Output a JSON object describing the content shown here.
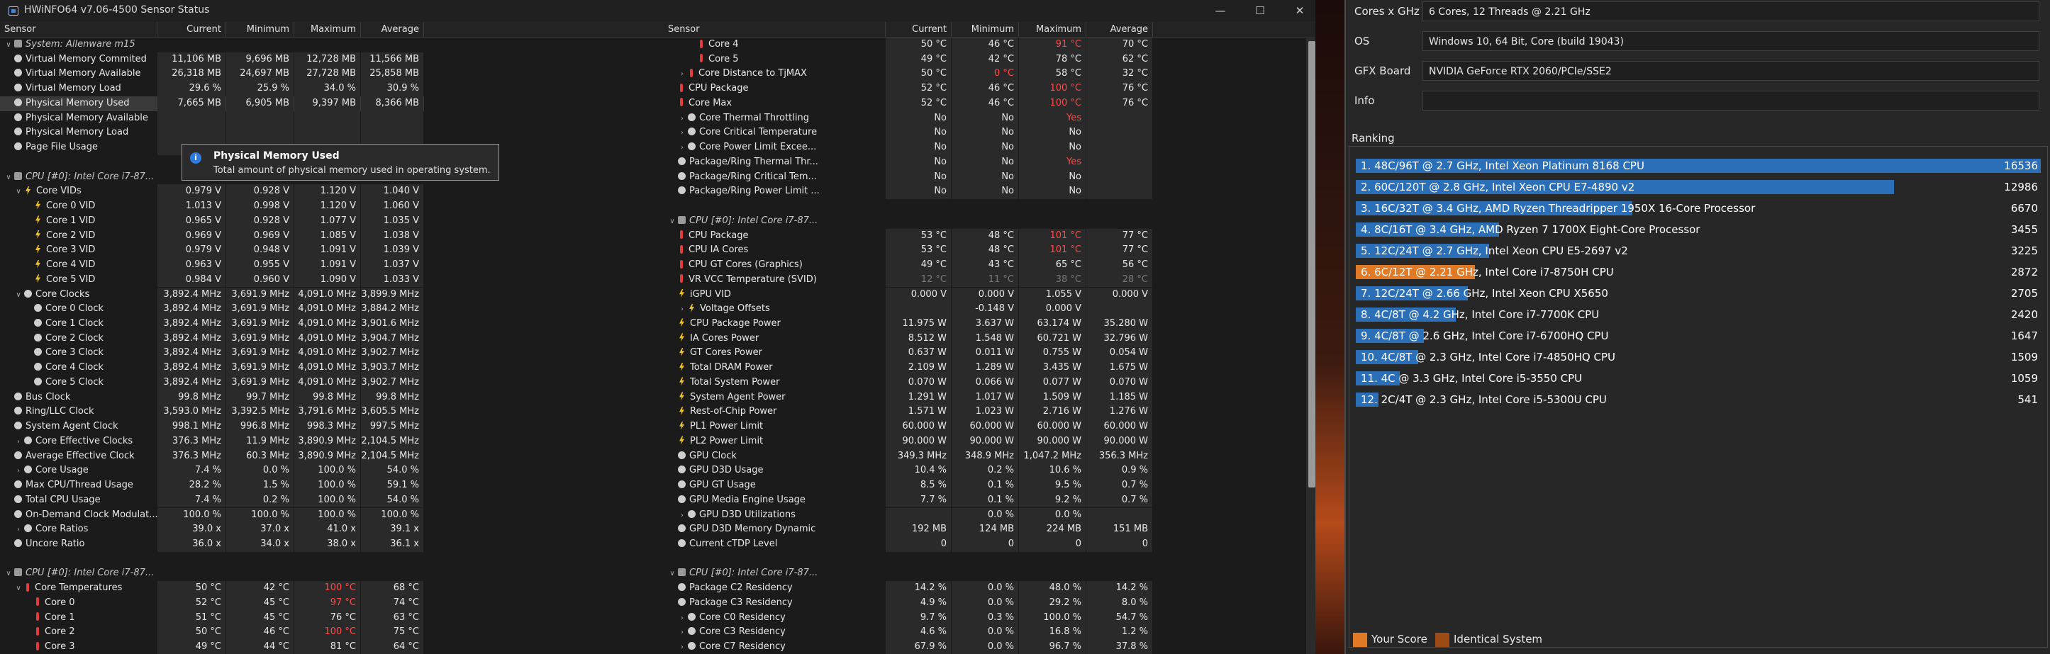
{
  "window": {
    "title": "HWiNFO64 v7.06-4500 Sensor Status",
    "minimize": "—",
    "maximize": "☐",
    "close": "✕"
  },
  "columns": {
    "sensor": "Sensor",
    "current": "Current",
    "minimum": "Minimum",
    "maximum": "Maximum",
    "average": "Average"
  },
  "left_rows": [
    {
      "name": "System: Allenware m15",
      "kind": "grp",
      "arrow": "v",
      "icon": "chip",
      "cur": "",
      "min": "",
      "max": "",
      "avg": ""
    },
    {
      "name": "Virtual Memory Commited",
      "icon": "dot",
      "cur": "11,106 MB",
      "min": "9,696 MB",
      "max": "12,728 MB",
      "avg": "11,566 MB"
    },
    {
      "name": "Virtual Memory Available",
      "icon": "dot",
      "cur": "26,318 MB",
      "min": "24,697 MB",
      "max": "27,728 MB",
      "avg": "25,858 MB"
    },
    {
      "name": "Virtual Memory Load",
      "icon": "dot",
      "cur": "29.6 %",
      "min": "25.9 %",
      "max": "34.0 %",
      "avg": "30.9 %"
    },
    {
      "name": "Physical Memory Used",
      "icon": "dot",
      "cur": "7,665 MB",
      "min": "6,905 MB",
      "max": "9,397 MB",
      "avg": "8,366 MB",
      "sel": true
    },
    {
      "name": "Physical Memory Available",
      "icon": "dot",
      "cur": "",
      "min": "",
      "max": "",
      "avg": ""
    },
    {
      "name": "Physical Memory Load",
      "icon": "dot",
      "cur": "",
      "min": "",
      "max": "",
      "avg": ""
    },
    {
      "name": "Page File Usage",
      "icon": "dot",
      "cur": "",
      "min": "",
      "max": "",
      "avg": ""
    },
    {
      "name": "",
      "kind": "blank",
      "cur": "",
      "min": "",
      "max": "",
      "avg": ""
    },
    {
      "name": "CPU [#0]: Intel Core i7-87...",
      "kind": "grp",
      "arrow": "v",
      "icon": "chip",
      "cur": "",
      "min": "",
      "max": "",
      "avg": ""
    },
    {
      "name": "Core VIDs",
      "indent": 1,
      "arrow": "v",
      "icon": "bolt",
      "cur": "0.979 V",
      "min": "0.928 V",
      "max": "1.120 V",
      "avg": "1.040 V"
    },
    {
      "name": "Core 0 VID",
      "indent": 2,
      "icon": "bolt",
      "cur": "1.013 V",
      "min": "0.998 V",
      "max": "1.120 V",
      "avg": "1.060 V"
    },
    {
      "name": "Core 1 VID",
      "indent": 2,
      "icon": "bolt",
      "cur": "0.965 V",
      "min": "0.928 V",
      "max": "1.077 V",
      "avg": "1.035 V"
    },
    {
      "name": "Core 2 VID",
      "indent": 2,
      "icon": "bolt",
      "cur": "0.969 V",
      "min": "0.969 V",
      "max": "1.085 V",
      "avg": "1.038 V"
    },
    {
      "name": "Core 3 VID",
      "indent": 2,
      "icon": "bolt",
      "cur": "0.979 V",
      "min": "0.948 V",
      "max": "1.091 V",
      "avg": "1.039 V"
    },
    {
      "name": "Core 4 VID",
      "indent": 2,
      "icon": "bolt",
      "cur": "0.963 V",
      "min": "0.955 V",
      "max": "1.091 V",
      "avg": "1.037 V"
    },
    {
      "name": "Core 5 VID",
      "indent": 2,
      "icon": "bolt",
      "cur": "0.984 V",
      "min": "0.960 V",
      "max": "1.090 V",
      "avg": "1.033 V"
    },
    {
      "name": "Core Clocks",
      "indent": 1,
      "arrow": "v",
      "icon": "dot",
      "cur": "3,892.4 MHz",
      "min": "3,691.9 MHz",
      "max": "4,091.0 MHz",
      "avg": "3,899.9 MHz"
    },
    {
      "name": "Core 0 Clock",
      "indent": 2,
      "icon": "dot",
      "cur": "3,892.4 MHz",
      "min": "3,691.9 MHz",
      "max": "4,091.0 MHz",
      "avg": "3,884.2 MHz"
    },
    {
      "name": "Core 1 Clock",
      "indent": 2,
      "icon": "dot",
      "cur": "3,892.4 MHz",
      "min": "3,691.9 MHz",
      "max": "4,091.0 MHz",
      "avg": "3,901.6 MHz"
    },
    {
      "name": "Core 2 Clock",
      "indent": 2,
      "icon": "dot",
      "cur": "3,892.4 MHz",
      "min": "3,691.9 MHz",
      "max": "4,091.0 MHz",
      "avg": "3,904.7 MHz"
    },
    {
      "name": "Core 3 Clock",
      "indent": 2,
      "icon": "dot",
      "cur": "3,892.4 MHz",
      "min": "3,691.9 MHz",
      "max": "4,091.0 MHz",
      "avg": "3,902.7 MHz"
    },
    {
      "name": "Core 4 Clock",
      "indent": 2,
      "icon": "dot",
      "cur": "3,892.4 MHz",
      "min": "3,691.9 MHz",
      "max": "4,091.0 MHz",
      "avg": "3,903.7 MHz"
    },
    {
      "name": "Core 5 Clock",
      "indent": 2,
      "icon": "dot",
      "cur": "3,892.4 MHz",
      "min": "3,691.9 MHz",
      "max": "4,091.0 MHz",
      "avg": "3,902.7 MHz"
    },
    {
      "name": "Bus Clock",
      "icon": "dot",
      "cur": "99.8 MHz",
      "min": "99.7 MHz",
      "max": "99.8 MHz",
      "avg": "99.8 MHz"
    },
    {
      "name": "Ring/LLC Clock",
      "icon": "dot",
      "cur": "3,593.0 MHz",
      "min": "3,392.5 MHz",
      "max": "3,791.6 MHz",
      "avg": "3,605.5 MHz"
    },
    {
      "name": "System Agent Clock",
      "icon": "dot",
      "cur": "998.1 MHz",
      "min": "996.8 MHz",
      "max": "998.3 MHz",
      "avg": "997.5 MHz"
    },
    {
      "name": "Core Effective Clocks",
      "indent": 1,
      "arrow": ">",
      "icon": "dot",
      "cur": "376.3 MHz",
      "min": "11.9 MHz",
      "max": "3,890.9 MHz",
      "avg": "2,104.5 MHz"
    },
    {
      "name": "Average Effective Clock",
      "icon": "dot",
      "cur": "376.3 MHz",
      "min": "60.3 MHz",
      "max": "3,890.9 MHz",
      "avg": "2,104.5 MHz"
    },
    {
      "name": "Core Usage",
      "indent": 1,
      "arrow": ">",
      "icon": "dot",
      "cur": "7.4 %",
      "min": "0.0 %",
      "max": "100.0 %",
      "avg": "54.0 %"
    },
    {
      "name": "Max CPU/Thread Usage",
      "icon": "dot",
      "cur": "28.2 %",
      "min": "1.5 %",
      "max": "100.0 %",
      "avg": "59.1 %"
    },
    {
      "name": "Total CPU Usage",
      "icon": "dot",
      "cur": "7.4 %",
      "min": "0.2 %",
      "max": "100.0 %",
      "avg": "54.0 %"
    },
    {
      "name": "On-Demand Clock Modulat...",
      "icon": "dot",
      "cur": "100.0 %",
      "min": "100.0 %",
      "max": "100.0 %",
      "avg": "100.0 %"
    },
    {
      "name": "Core Ratios",
      "indent": 1,
      "arrow": ">",
      "icon": "dot",
      "cur": "39.0 x",
      "min": "37.0 x",
      "max": "41.0 x",
      "avg": "39.1 x"
    },
    {
      "name": "Uncore Ratio",
      "icon": "dot",
      "cur": "36.0 x",
      "min": "34.0 x",
      "max": "38.0 x",
      "avg": "36.1 x"
    },
    {
      "name": "",
      "kind": "blank",
      "cur": "",
      "min": "",
      "max": "",
      "avg": ""
    },
    {
      "name": "CPU [#0]: Intel Core i7-87...",
      "kind": "grp",
      "arrow": "v",
      "icon": "chip",
      "cur": "",
      "min": "",
      "max": "",
      "avg": ""
    },
    {
      "name": "Core Temperatures",
      "indent": 1,
      "arrow": "v",
      "icon": "th",
      "cur": "50 °C",
      "min": "42 °C",
      "max": "100 °C",
      "avg": "68 °C",
      "maxred": true
    },
    {
      "name": "Core 0",
      "indent": 2,
      "icon": "th",
      "cur": "52 °C",
      "min": "45 °C",
      "max": "97 °C",
      "avg": "74 °C",
      "maxred": true
    },
    {
      "name": "Core 1",
      "indent": 2,
      "icon": "th",
      "cur": "51 °C",
      "min": "45 °C",
      "max": "76 °C",
      "avg": "63 °C"
    },
    {
      "name": "Core 2",
      "indent": 2,
      "icon": "th",
      "cur": "50 °C",
      "min": "46 °C",
      "max": "100 °C",
      "avg": "75 °C",
      "maxred": true
    },
    {
      "name": "Core 3",
      "indent": 2,
      "icon": "th",
      "cur": "49 °C",
      "min": "44 °C",
      "max": "81 °C",
      "avg": "64 °C"
    }
  ],
  "tooltip": {
    "title": "Physical Memory Used",
    "desc": "Total amount of physical memory used in operating system.",
    "icon": "i"
  },
  "right_rows": [
    {
      "name": "Core 4",
      "indent": 2,
      "icon": "th",
      "cur": "50 °C",
      "min": "46 °C",
      "max": "91 °C",
      "avg": "70 °C",
      "maxred": true
    },
    {
      "name": "Core 5",
      "indent": 2,
      "icon": "th",
      "cur": "49 °C",
      "min": "42 °C",
      "max": "78 °C",
      "avg": "62 °C"
    },
    {
      "name": "Core Distance to TjMAX",
      "indent": 1,
      "arrow": ">",
      "icon": "th",
      "cur": "50 °C",
      "min": "0 °C",
      "max": "58 °C",
      "avg": "32 °C",
      "minred": true
    },
    {
      "name": "CPU Package",
      "icon": "th",
      "cur": "52 °C",
      "min": "46 °C",
      "max": "100 °C",
      "avg": "76 °C",
      "maxred": true
    },
    {
      "name": "Core Max",
      "icon": "th",
      "cur": "52 °C",
      "min": "46 °C",
      "max": "100 °C",
      "avg": "76 °C",
      "maxred": true
    },
    {
      "name": "Core Thermal Throttling",
      "indent": 1,
      "arrow": ">",
      "icon": "dot",
      "cur": "No",
      "min": "No",
      "max": "Yes",
      "avg": "",
      "maxred": true
    },
    {
      "name": "Core Critical Temperature",
      "indent": 1,
      "arrow": ">",
      "icon": "dot",
      "cur": "No",
      "min": "No",
      "max": "No",
      "avg": ""
    },
    {
      "name": "Core Power Limit Excee...",
      "indent": 1,
      "arrow": ">",
      "icon": "dot",
      "cur": "No",
      "min": "No",
      "max": "No",
      "avg": ""
    },
    {
      "name": "Package/Ring Thermal Thr...",
      "icon": "dot",
      "cur": "No",
      "min": "No",
      "max": "Yes",
      "avg": "",
      "maxred": true
    },
    {
      "name": "Package/Ring Critical Tem...",
      "icon": "dot",
      "cur": "No",
      "min": "No",
      "max": "No",
      "avg": ""
    },
    {
      "name": "Package/Ring Power Limit ...",
      "icon": "dot",
      "cur": "No",
      "min": "No",
      "max": "No",
      "avg": ""
    },
    {
      "name": "",
      "kind": "blank",
      "cur": "",
      "min": "",
      "max": "",
      "avg": ""
    },
    {
      "name": "CPU [#0]: Intel Core i7-87...",
      "kind": "grp",
      "arrow": "v",
      "icon": "chip",
      "cur": "",
      "min": "",
      "max": "",
      "avg": ""
    },
    {
      "name": "CPU Package",
      "icon": "th",
      "cur": "53 °C",
      "min": "48 °C",
      "max": "101 °C",
      "avg": "77 °C",
      "maxred": true
    },
    {
      "name": "CPU IA Cores",
      "icon": "th",
      "cur": "53 °C",
      "min": "48 °C",
      "max": "101 °C",
      "avg": "77 °C",
      "maxred": true
    },
    {
      "name": "CPU GT Cores (Graphics)",
      "icon": "th",
      "cur": "49 °C",
      "min": "43 °C",
      "max": "65 °C",
      "avg": "56 °C"
    },
    {
      "name": "VR VCC Temperature (SVID)",
      "icon": "th",
      "cur": "12 °C",
      "min": "11 °C",
      "max": "38 °C",
      "avg": "28 °C",
      "dim": true
    },
    {
      "name": "iGPU VID",
      "icon": "bolt",
      "cur": "0.000 V",
      "min": "0.000 V",
      "max": "1.055 V",
      "avg": "0.000 V"
    },
    {
      "name": "Voltage Offsets",
      "indent": 1,
      "arrow": ">",
      "icon": "bolt",
      "cur": "",
      "min": "-0.148 V",
      "max": "0.000 V",
      "avg": ""
    },
    {
      "name": "CPU Package Power",
      "icon": "bolt",
      "cur": "11.975 W",
      "min": "3.637 W",
      "max": "63.174 W",
      "avg": "35.280 W"
    },
    {
      "name": "IA Cores Power",
      "icon": "bolt",
      "cur": "8.512 W",
      "min": "1.548 W",
      "max": "60.721 W",
      "avg": "32.796 W"
    },
    {
      "name": "GT Cores Power",
      "icon": "bolt",
      "cur": "0.637 W",
      "min": "0.011 W",
      "max": "0.755 W",
      "avg": "0.054 W"
    },
    {
      "name": "Total DRAM Power",
      "icon": "bolt",
      "cur": "2.109 W",
      "min": "1.289 W",
      "max": "3.435 W",
      "avg": "1.675 W"
    },
    {
      "name": "Total System Power",
      "icon": "bolt",
      "cur": "0.070 W",
      "min": "0.066 W",
      "max": "0.077 W",
      "avg": "0.070 W"
    },
    {
      "name": "System Agent Power",
      "icon": "bolt",
      "cur": "1.291 W",
      "min": "1.017 W",
      "max": "1.509 W",
      "avg": "1.185 W"
    },
    {
      "name": "Rest-of-Chip Power",
      "icon": "bolt",
      "cur": "1.571 W",
      "min": "1.023 W",
      "max": "2.716 W",
      "avg": "1.276 W"
    },
    {
      "name": "PL1 Power Limit",
      "icon": "bolt",
      "cur": "60.000 W",
      "min": "60.000 W",
      "max": "60.000 W",
      "avg": "60.000 W"
    },
    {
      "name": "PL2 Power Limit",
      "icon": "bolt",
      "cur": "90.000 W",
      "min": "90.000 W",
      "max": "90.000 W",
      "avg": "90.000 W"
    },
    {
      "name": "GPU Clock",
      "icon": "dot",
      "cur": "349.3 MHz",
      "min": "348.9 MHz",
      "max": "1,047.2 MHz",
      "avg": "356.3 MHz"
    },
    {
      "name": "GPU D3D Usage",
      "icon": "dot",
      "cur": "10.4 %",
      "min": "0.2 %",
      "max": "10.6 %",
      "avg": "0.9 %"
    },
    {
      "name": "GPU GT Usage",
      "icon": "dot",
      "cur": "8.5 %",
      "min": "0.1 %",
      "max": "9.5 %",
      "avg": "0.7 %"
    },
    {
      "name": "GPU Media Engine Usage",
      "icon": "dot",
      "cur": "7.7 %",
      "min": "0.1 %",
      "max": "9.2 %",
      "avg": "0.7 %"
    },
    {
      "name": "GPU D3D Utilizations",
      "indent": 1,
      "arrow": ">",
      "icon": "dot",
      "cur": "",
      "min": "0.0 %",
      "max": "0.0 %",
      "avg": ""
    },
    {
      "name": "GPU D3D Memory Dynamic",
      "icon": "dot",
      "cur": "192 MB",
      "min": "124 MB",
      "max": "224 MB",
      "avg": "151 MB"
    },
    {
      "name": "Current cTDP Level",
      "icon": "dot",
      "cur": "0",
      "min": "0",
      "max": "0",
      "avg": "0"
    },
    {
      "name": "",
      "kind": "blank",
      "cur": "",
      "min": "",
      "max": "",
      "avg": ""
    },
    {
      "name": "CPU [#0]: Intel Core i7-87...",
      "kind": "grp",
      "arrow": "v",
      "icon": "chip",
      "cur": "",
      "min": "",
      "max": "",
      "avg": ""
    },
    {
      "name": "Package C2 Residency",
      "icon": "dot",
      "cur": "14.2 %",
      "min": "0.0 %",
      "max": "48.0 %",
      "avg": "14.2 %"
    },
    {
      "name": "Package C3 Residency",
      "icon": "dot",
      "cur": "4.9 %",
      "min": "0.0 %",
      "max": "29.2 %",
      "avg": "8.0 %"
    },
    {
      "name": "Core C0 Residency",
      "indent": 1,
      "arrow": ">",
      "icon": "dot",
      "cur": "9.7 %",
      "min": "0.3 %",
      "max": "100.0 %",
      "avg": "54.7 %"
    },
    {
      "name": "Core C3 Residency",
      "indent": 1,
      "arrow": ">",
      "icon": "dot",
      "cur": "4.6 %",
      "min": "0.0 %",
      "max": "16.8 %",
      "avg": "1.2 %"
    },
    {
      "name": "Core C7 Residency",
      "indent": 1,
      "arrow": ">",
      "icon": "dot",
      "cur": "67.9 %",
      "min": "0.0 %",
      "max": "96.7 %",
      "avg": "37.8 %"
    }
  ],
  "info": [
    {
      "label": "Cores x GHz",
      "value": "6 Cores, 12 Threads @ 2.21 GHz"
    },
    {
      "label": "OS",
      "value": "Windows 10, 64 Bit, Core (build 19043)"
    },
    {
      "label": "GFX Board",
      "value": "NVIDIA GeForce RTX 2060/PCIe/SSE2"
    },
    {
      "label": "Info",
      "value": ""
    }
  ],
  "ranking": {
    "title": "Ranking",
    "max_score": 16536,
    "items": [
      {
        "label": "1. 48C/96T @ 2.7 GHz, Intel Xeon Platinum 8168 CPU",
        "score": "16536",
        "value": 16536,
        "highlight": false
      },
      {
        "label": "2. 60C/120T @ 2.8 GHz, Intel Xeon CPU E7-4890 v2",
        "score": "12986",
        "value": 12986,
        "highlight": false
      },
      {
        "label": "3. 16C/32T @ 3.4 GHz, AMD Ryzen Threadripper 1950X 16-Core Processor",
        "score": "6670",
        "value": 6670,
        "highlight": false
      },
      {
        "label": "4. 8C/16T @ 3.4 GHz, AMD Ryzen 7 1700X Eight-Core Processor",
        "score": "3455",
        "value": 3455,
        "highlight": false
      },
      {
        "label": "5. 12C/24T @ 2.7 GHz, Intel Xeon CPU E5-2697 v2",
        "score": "3225",
        "value": 3225,
        "highlight": false
      },
      {
        "label": "6. 6C/12T @ 2.21 GHz, Intel Core i7-8750H CPU",
        "score": "2872",
        "value": 2872,
        "highlight": true
      },
      {
        "label": "7. 12C/24T @ 2.66 GHz, Intel Xeon CPU X5650",
        "score": "2705",
        "value": 2705,
        "highlight": false
      },
      {
        "label": "8. 4C/8T @ 4.2 GHz, Intel Core i7-7700K CPU",
        "score": "2420",
        "value": 2420,
        "highlight": false
      },
      {
        "label": "9. 4C/8T @ 2.6 GHz, Intel Core i7-6700HQ CPU",
        "score": "1647",
        "value": 1647,
        "highlight": false
      },
      {
        "label": "10. 4C/8T @ 2.3 GHz, Intel Core i7-4850HQ CPU",
        "score": "1509",
        "value": 1509,
        "highlight": false
      },
      {
        "label": "11. 4C @ 3.3 GHz, Intel Core i5-3550 CPU",
        "score": "1059",
        "value": 1059,
        "highlight": false
      },
      {
        "label": "12. 2C/4T @ 2.3 GHz, Intel Core i5-5300U CPU",
        "score": "541",
        "value": 541,
        "highlight": false
      }
    ]
  },
  "legend": {
    "your_score": "Your Score",
    "identical": "Identical System"
  },
  "colors": {
    "bar": "#2a6fb8",
    "highlight": "#e07a26",
    "identical": "#9c4a16",
    "red": "#ff4a4a"
  }
}
